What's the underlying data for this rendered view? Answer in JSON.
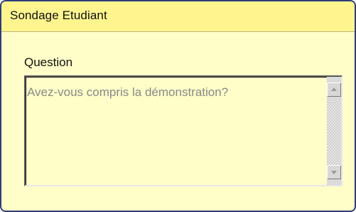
{
  "dialog": {
    "title": "Sondage Etudiant"
  },
  "question": {
    "label": "Question",
    "text": "Avez-vous compris la démonstration?"
  },
  "scrollbar": {
    "up_icon": "arrow-up-icon",
    "down_icon": "arrow-down-icon"
  },
  "colors": {
    "title_bar": "#fef58f",
    "background": "#fffdc8",
    "border": "#2f3d7a",
    "placeholder_text": "#8a8a8a"
  }
}
